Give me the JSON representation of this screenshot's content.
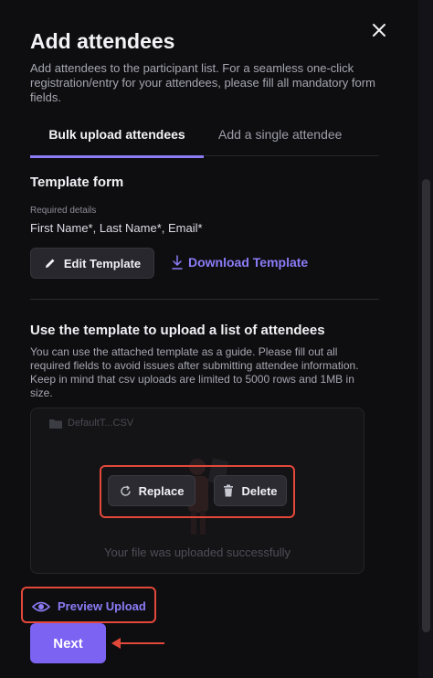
{
  "modal": {
    "title": "Add attendees",
    "intro": "Add attendees to the participant list. For a seamless one-click registration/entry for your attendees, please fill all mandatory form fields."
  },
  "tabs": [
    {
      "label": "Bulk upload attendees",
      "active": true
    },
    {
      "label": "Add a single attendee",
      "active": false
    }
  ],
  "template_form": {
    "title": "Template form",
    "required_label": "Required details",
    "required_fields": "First Name*, Last Name*, Email*",
    "edit_button": "Edit Template",
    "download_link": "Download Template"
  },
  "upload": {
    "title": "Use the template to upload a list of attendees",
    "description": "You can use the attached template as a guide. Please fill out all required fields to avoid issues after submitting attendee information. Keep in mind that csv uploads are limited to 5000 rows and 1MB in size.",
    "file_name": "DefaultT...CSV",
    "success_text": "Your file was uploaded successfully",
    "replace_button": "Replace",
    "delete_button": "Delete"
  },
  "preview_link": "Preview Upload",
  "next_button": "Next",
  "colors": {
    "accent": "#8b7cf6",
    "primary_button": "#7c63f2",
    "highlight": "#e2483a",
    "background": "#0e0e11"
  },
  "icons": [
    "close-icon",
    "pencil-icon",
    "download-icon",
    "folder-icon",
    "refresh-icon",
    "trash-icon",
    "eye-icon",
    "arrow-left-icon"
  ]
}
